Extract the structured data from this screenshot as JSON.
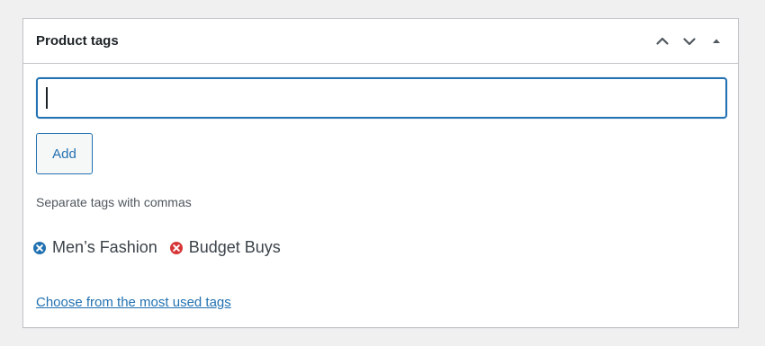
{
  "metabox": {
    "title": "Product tags",
    "controls": {
      "move_up": "chevron-up-icon",
      "move_down": "chevron-down-icon",
      "toggle": "triangle-up-icon"
    }
  },
  "form": {
    "input_value": "",
    "add_label": "Add",
    "helper_text": "Separate tags with commas"
  },
  "tags": [
    {
      "label": "Men’s Fashion",
      "remove_icon": "remove-circle-icon",
      "icon_color": "#2271b1"
    },
    {
      "label": "Budget Buys",
      "remove_icon": "remove-circle-icon",
      "icon_color": "#d63638"
    }
  ],
  "links": {
    "most_used": "Choose from the most used tags"
  },
  "colors": {
    "accent": "#2271b1",
    "danger": "#d63638",
    "border": "#c3c4c7",
    "text": "#3c434a"
  }
}
